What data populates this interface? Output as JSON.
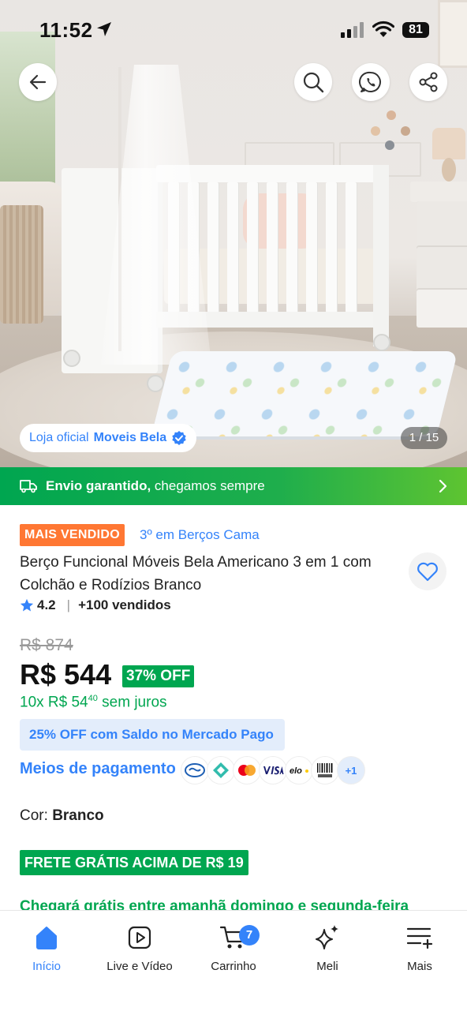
{
  "status_bar": {
    "time": "11:52",
    "battery": "81"
  },
  "hero": {
    "store_chip": {
      "label": "Loja oficial",
      "store_name": "Moveis Bela"
    },
    "image_counter": "1 / 15",
    "icons": [
      "back-arrow-icon",
      "search-icon",
      "whatsapp-icon",
      "share-icon"
    ]
  },
  "shipping_banner": {
    "bold": "Envio garantido,",
    "text": " chegamos sempre"
  },
  "product": {
    "best_seller_badge": "MAIS VENDIDO",
    "rank": "3º em Berços Cama",
    "title": "Berço Funcional Móveis Bela Americano 3 em 1 com Colchão e Rodízios Branco",
    "rating": "4.2",
    "sold": "+100 vendidos",
    "old_price": "R$ 874",
    "price": "R$ 544",
    "discount": "37% OFF",
    "installments_prefix": "10x R$ 54",
    "installments_cents": "40",
    "installments_suffix": " sem juros",
    "mp_offer": "25% OFF com Saldo no Mercado Pago",
    "payment_link": "Meios de pagamento",
    "payment_more": "+1",
    "color_label": "Cor: ",
    "color_value": "Branco",
    "free_shipping_badge": "FRETE GRÁTIS ACIMA DE R$ 19",
    "arrival": "Chegará grátis entre amanhã domingo e segunda-feira"
  },
  "colors": {
    "accent": "#3483fa",
    "green": "#00a650",
    "orange": "#ff7733"
  },
  "bottom_nav": {
    "items": [
      {
        "label": "Início",
        "icon": "home-icon"
      },
      {
        "label": "Live e Vídeo",
        "icon": "play-icon"
      },
      {
        "label": "Carrinho",
        "icon": "cart-icon"
      },
      {
        "label": "Meli",
        "icon": "sparkle-icon"
      },
      {
        "label": "Mais",
        "icon": "menu-plus-icon"
      }
    ],
    "cart_count": "7"
  }
}
